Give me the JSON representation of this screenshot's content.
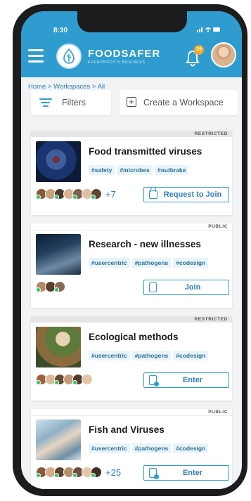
{
  "status_bar": {
    "time": "8:30",
    "icons": "signal-wifi-battery"
  },
  "app_bar": {
    "brand": "FOODSAFER",
    "tagline": "EVERYBODY'S BUSINESS",
    "notification_count": "29"
  },
  "breadcrumb": "Home > Workspaces > All",
  "toolbar": {
    "filters_label": "Filters",
    "create_label": "Create a Workspace"
  },
  "colors": {
    "primary": "#2e9ccf",
    "tag_bg": "#e9f4fa",
    "online": "#33c46a",
    "badge": "#f5a623"
  },
  "cards": [
    {
      "privacy": "RESTRICTED",
      "title": "Food transmitted viruses",
      "tags": [
        "#safety",
        "#microbes",
        "#outbrake"
      ],
      "member_extra": "+7",
      "action_label": "Request to Join",
      "action_icon": "lock-icon"
    },
    {
      "privacy": "PUBLIC",
      "title": "Research - new illnesses",
      "tags": [
        "#usercentric",
        "#pathogens",
        "#codesign"
      ],
      "member_extra": "",
      "action_label": "Join",
      "action_icon": "door-icon"
    },
    {
      "privacy": "RESTRICTED",
      "title": "Ecological methods",
      "tags": [
        "#usercentric",
        "#pathogens",
        "#codesign"
      ],
      "member_extra": "",
      "action_label": "Enter",
      "action_icon": "enter-icon"
    },
    {
      "privacy": "PUBLIC",
      "title": "Fish and Viruses",
      "tags": [
        "#usercentric",
        "#pathogens",
        "#codesign"
      ],
      "member_extra": "+25",
      "action_label": "Enter",
      "action_icon": "enter-icon"
    }
  ]
}
